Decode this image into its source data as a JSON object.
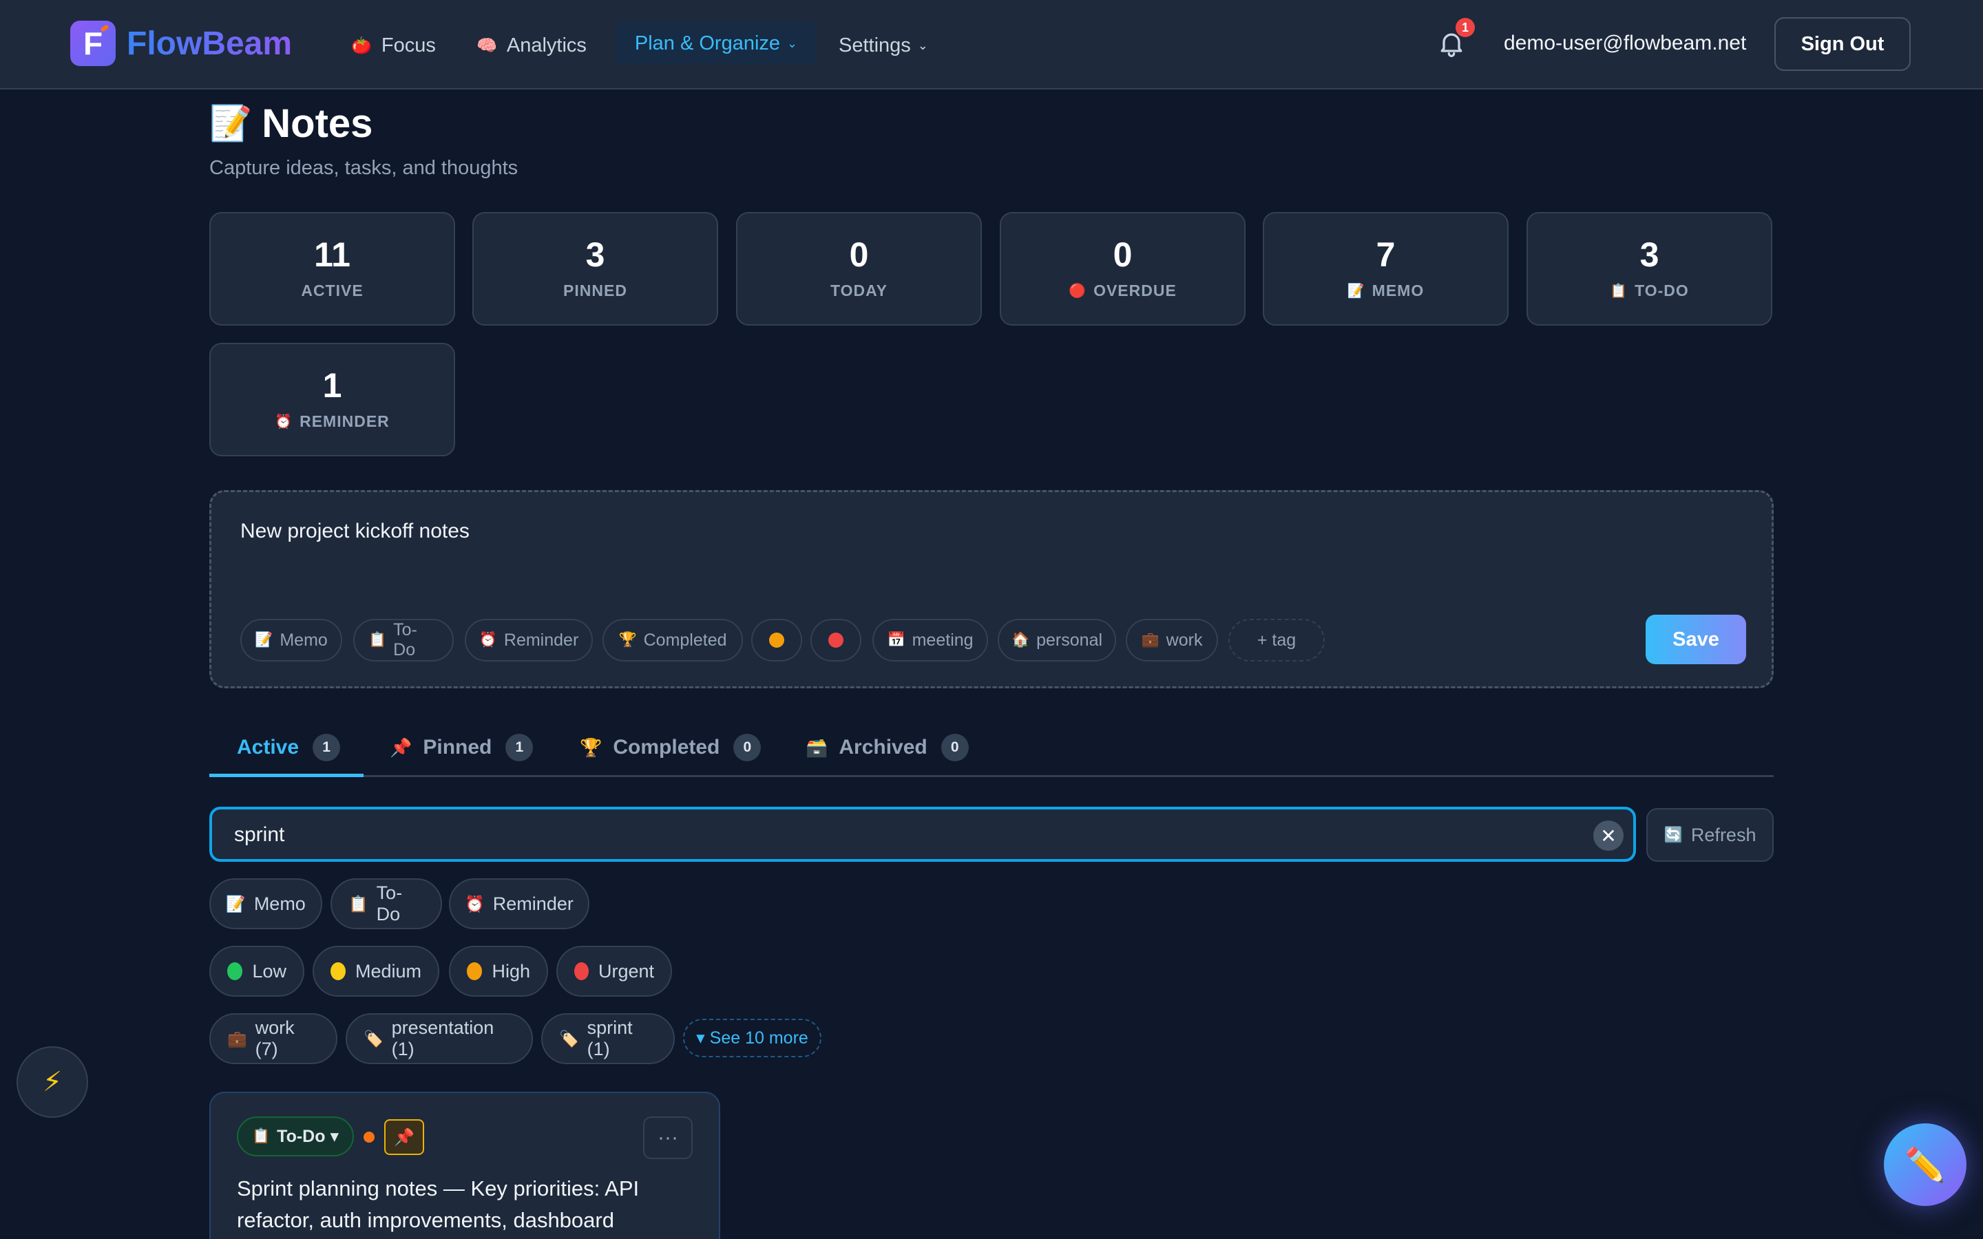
{
  "header": {
    "brand": "FlowBeam",
    "brand_letter": "F",
    "nav": [
      {
        "emoji": "🍅",
        "label": "Focus"
      },
      {
        "emoji": "🧠",
        "label": "Analytics"
      },
      {
        "label": "Plan & Organize",
        "active": true
      },
      {
        "label": "Settings"
      }
    ],
    "notification_count": "1",
    "user_email": "demo-user@flowbeam.net",
    "sign_out": "Sign Out"
  },
  "page": {
    "title_emoji": "📝",
    "title": "Notes",
    "subtitle": "Capture ideas, tasks, and thoughts"
  },
  "stats": [
    {
      "value": "11",
      "label": "ACTIVE"
    },
    {
      "value": "3",
      "label": "PINNED"
    },
    {
      "value": "0",
      "label": "TODAY"
    },
    {
      "value": "0",
      "emoji": "🔴",
      "label": "OVERDUE"
    },
    {
      "value": "7",
      "emoji": "📝",
      "label": "MEMO"
    },
    {
      "value": "3",
      "emoji": "📋",
      "label": "TO-DO"
    },
    {
      "value": "1",
      "emoji": "⏰",
      "label": "REMINDER"
    }
  ],
  "composer": {
    "text": "New project kickoff notes",
    "chips": [
      {
        "emoji": "📝",
        "label": "Memo"
      },
      {
        "emoji": "📋",
        "label": "To-Do"
      },
      {
        "emoji": "⏰",
        "label": "Reminder"
      },
      {
        "emoji": "🏆",
        "label": "Completed"
      },
      {
        "color": "#f59e0b",
        "label": ""
      },
      {
        "color": "#ef4444",
        "label": ""
      },
      {
        "emoji": "📅",
        "label": "meeting"
      },
      {
        "emoji": "🏠",
        "label": "personal"
      },
      {
        "emoji": "💼",
        "label": "work"
      },
      {
        "label": "+ tag"
      }
    ],
    "save": "Save"
  },
  "tabs": [
    {
      "label": "Active",
      "count": "1",
      "active": true
    },
    {
      "emoji": "📌",
      "label": "Pinned",
      "count": "1"
    },
    {
      "emoji": "🏆",
      "label": "Completed",
      "count": "0"
    },
    {
      "emoji": "🗃️",
      "label": "Archived",
      "count": "0"
    }
  ],
  "search": {
    "value": "sprint",
    "clear": "✕",
    "refresh_emoji": "🔄",
    "refresh": "Refresh"
  },
  "filters": {
    "types": [
      {
        "emoji": "📝",
        "label": "Memo"
      },
      {
        "emoji": "📋",
        "label": "To-Do"
      },
      {
        "emoji": "⏰",
        "label": "Reminder"
      }
    ],
    "priorities": [
      {
        "color": "#22c55e",
        "label": "Low"
      },
      {
        "color": "#facc15",
        "label": "Medium"
      },
      {
        "color": "#f59e0b",
        "label": "High"
      },
      {
        "color": "#ef4444",
        "label": "Urgent"
      }
    ],
    "tags": [
      {
        "emoji": "💼",
        "label": "work (7)"
      },
      {
        "emoji": "🏷️",
        "label": "presentation (1)"
      },
      {
        "emoji": "🏷️",
        "label": "sprint (1)"
      }
    ],
    "see_more": "▾ See 10 more"
  },
  "note": {
    "type_emoji": "📋",
    "type": "To-Do ▾",
    "pin": "📌",
    "menu": "···",
    "text": "Sprint planning notes — Key priorities: API refactor, auth improvements, dashboard"
  },
  "floating": {
    "quick": "⚡",
    "fab": "✏️"
  }
}
